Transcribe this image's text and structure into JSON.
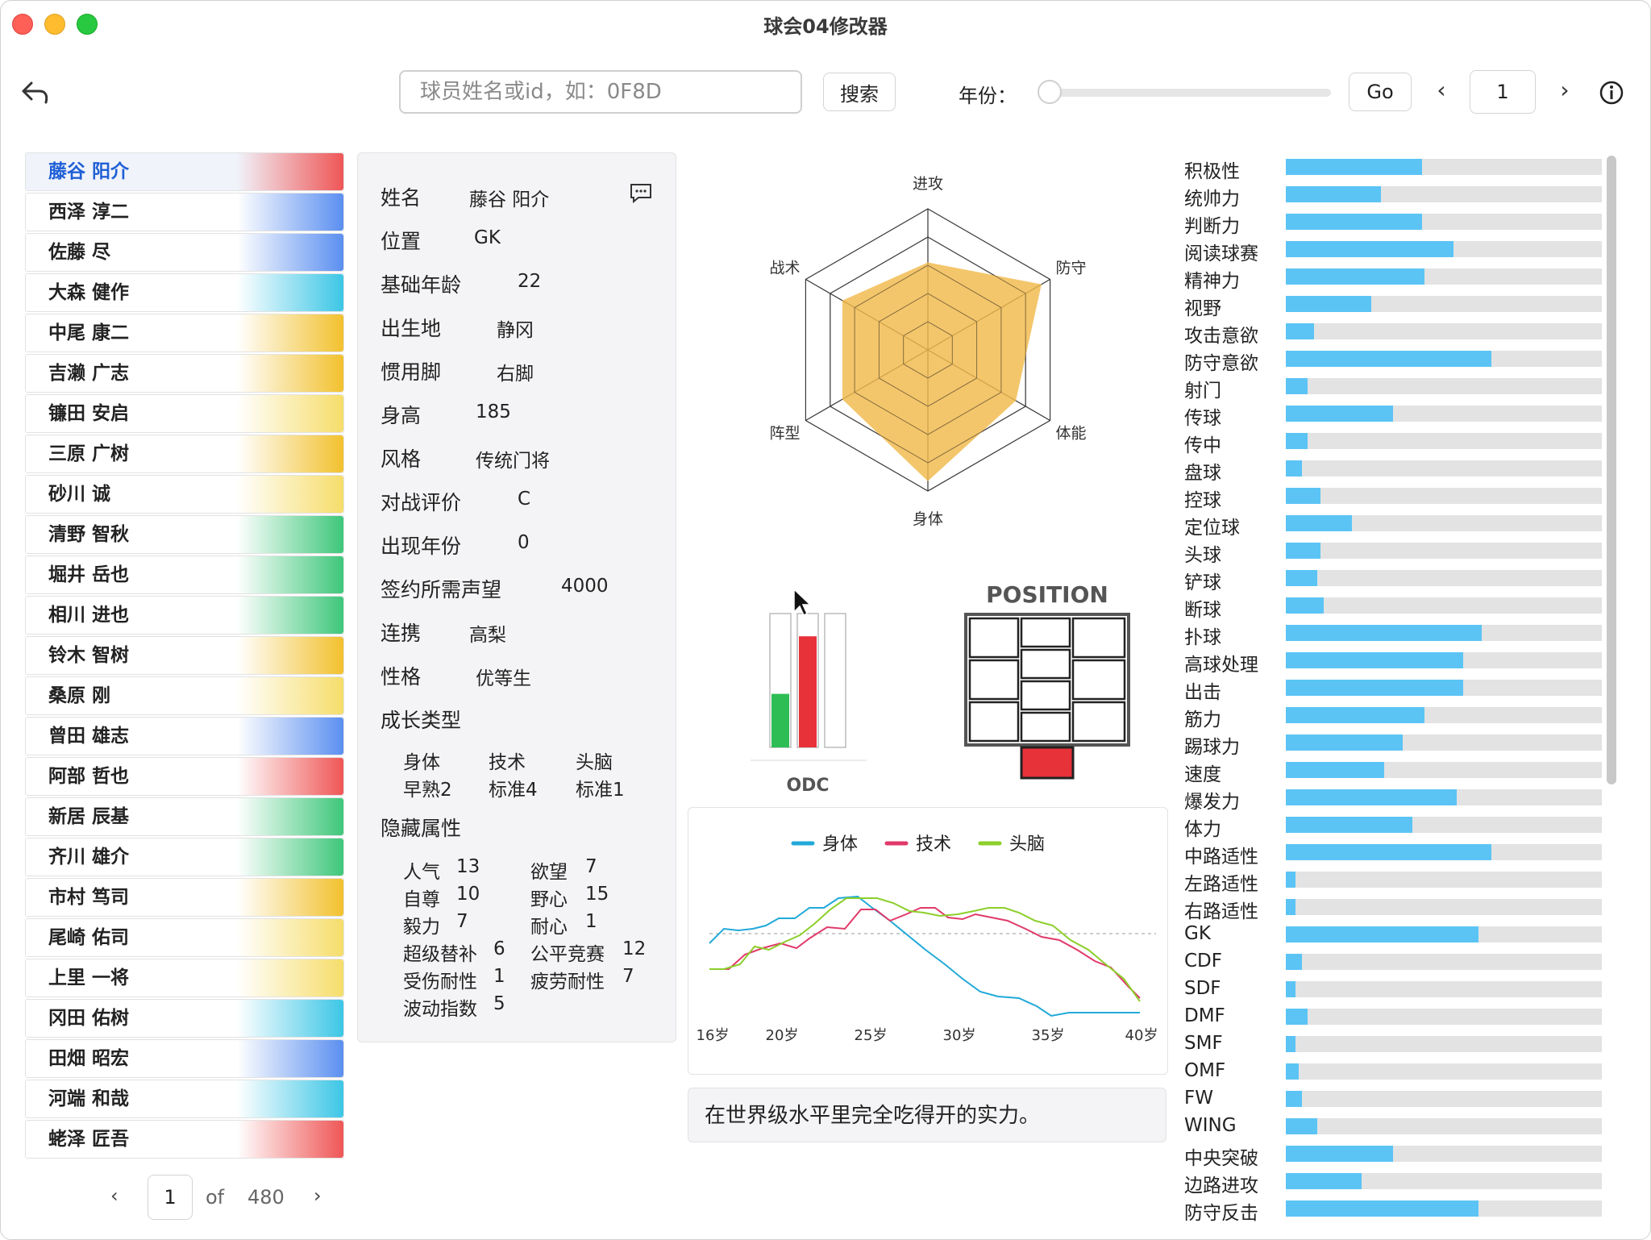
{
  "window": {
    "title": "球会04修改器"
  },
  "toolbar": {
    "search_placeholder": "球员姓名或id，如：0F8D",
    "search_button": "搜索",
    "year_label": "年份：",
    "year_slider_value": 0,
    "go_button": "Go",
    "page_prev": "‹",
    "page_value": "1",
    "page_next": "›"
  },
  "players": [
    {
      "name": "藤谷 阳介",
      "color": "#ef5656",
      "selected": true
    },
    {
      "name": "西泽 淳二",
      "color": "#5b8ff0"
    },
    {
      "name": "佐藤 尽",
      "color": "#5b8ff0"
    },
    {
      "name": "大森 健作",
      "color": "#3cc6e6"
    },
    {
      "name": "中尾 康二",
      "color": "#f2c12e"
    },
    {
      "name": "吉濑 广志",
      "color": "#f2c12e"
    },
    {
      "name": "镰田 安启",
      "color": "#f6dd6a"
    },
    {
      "name": "三原 广树",
      "color": "#f2c12e"
    },
    {
      "name": "砂川 诚",
      "color": "#f6dd6a"
    },
    {
      "name": "清野 智秋",
      "color": "#3ec77a"
    },
    {
      "name": "堀井 岳也",
      "color": "#3ec77a"
    },
    {
      "name": "相川 进也",
      "color": "#3ec77a"
    },
    {
      "name": "铃木 智树",
      "color": "#f2c12e"
    },
    {
      "name": "桑原 刚",
      "color": "#f6dd6a"
    },
    {
      "name": "曾田 雄志",
      "color": "#5b8ff0"
    },
    {
      "name": "阿部 哲也",
      "color": "#ef5656"
    },
    {
      "name": "新居 辰基",
      "color": "#3ec77a"
    },
    {
      "name": "齐川 雄介",
      "color": "#3ec77a"
    },
    {
      "name": "市村 笃司",
      "color": "#f2c12e"
    },
    {
      "name": "尾崎 佑司",
      "color": "#f6dd6a"
    },
    {
      "name": "上里 一将",
      "color": "#f6dd6a"
    },
    {
      "name": "冈田 佑树",
      "color": "#3cc6e6"
    },
    {
      "name": "田畑 昭宏",
      "color": "#5b8ff0"
    },
    {
      "name": "河端 和哉",
      "color": "#3cc6e6"
    },
    {
      "name": "蛯泽 匠吾",
      "color": "#ef5656"
    }
  ],
  "pager": {
    "prev": "‹",
    "current": "1",
    "of": "of",
    "total": "480",
    "next": "›"
  },
  "info": {
    "name_label": "姓名",
    "name_value": "藤谷 阳介",
    "pos_label": "位置",
    "pos_value": "GK",
    "age_label": "基础年龄",
    "age_value": "22",
    "birth_label": "出生地",
    "birth_value": "静冈",
    "foot_label": "惯用脚",
    "foot_value": "右脚",
    "height_label": "身高",
    "height_value": "185",
    "style_label": "风格",
    "style_value": "传统门将",
    "rating_label": "对战评价",
    "rating_value": "C",
    "year_label": "出现年份",
    "year_value": "0",
    "fame_label": "签约所需声望",
    "fame_value": "4000",
    "link_label": "连携",
    "link_value": "高梨",
    "char_label": "性格",
    "char_value": "优等生",
    "growth_label": "成长类型",
    "growth": [
      {
        "head": "身体",
        "val": "早熟2"
      },
      {
        "head": "技术",
        "val": "标准4"
      },
      {
        "head": "头脑",
        "val": "标准1"
      }
    ],
    "hidden_label": "隐藏属性",
    "hidden": [
      {
        "k": "人气",
        "v": "13"
      },
      {
        "k": "欲望",
        "v": "7"
      },
      {
        "k": "自尊",
        "v": "10"
      },
      {
        "k": "野心",
        "v": "15"
      },
      {
        "k": "毅力",
        "v": "7"
      },
      {
        "k": "耐心",
        "v": "1"
      },
      {
        "k": "超级替补",
        "v": "6"
      },
      {
        "k": "公平竞赛",
        "v": "12"
      },
      {
        "k": "受伤耐性",
        "v": "1"
      },
      {
        "k": "疲劳耐性",
        "v": "7"
      },
      {
        "k": "波动指数",
        "v": "5"
      }
    ]
  },
  "radar": {
    "labels": [
      "进攻",
      "防守",
      "体能",
      "身体",
      "阵型",
      "战术"
    ],
    "values": [
      0.62,
      0.93,
      0.72,
      0.93,
      0.7,
      0.7
    ],
    "fill_color": "#f2b94b"
  },
  "odc": {
    "label": "ODC",
    "levels": [
      0.4,
      0.83,
      0.0
    ],
    "colors": [
      "#2ebd55",
      "#e8323a",
      "#ffffff"
    ]
  },
  "position": {
    "title": "POSITION",
    "active": "GK",
    "active_color": "#e8323a"
  },
  "growth_chart": {
    "legend": [
      {
        "name": "身体",
        "color": "#21a9d8"
      },
      {
        "name": "技术",
        "color": "#e03a6a"
      },
      {
        "name": "头脑",
        "color": "#8ccf2a"
      }
    ],
    "x_labels": [
      "16岁",
      "20岁",
      "25岁",
      "30岁",
      "35岁",
      "40岁"
    ]
  },
  "description": "在世界级水平里完全吃得开的实力。",
  "attributes": [
    {
      "name": "积极性",
      "value": 0.43
    },
    {
      "name": "统帅力",
      "value": 0.3
    },
    {
      "name": "判断力",
      "value": 0.43
    },
    {
      "name": "阅读球赛",
      "value": 0.53
    },
    {
      "name": "精神力",
      "value": 0.44
    },
    {
      "name": "视野",
      "value": 0.27
    },
    {
      "name": "攻击意欲",
      "value": 0.09
    },
    {
      "name": "防守意欲",
      "value": 0.65
    },
    {
      "name": "射门",
      "value": 0.07
    },
    {
      "name": "传球",
      "value": 0.34
    },
    {
      "name": "传中",
      "value": 0.07
    },
    {
      "name": "盘球",
      "value": 0.05
    },
    {
      "name": "控球",
      "value": 0.11
    },
    {
      "name": "定位球",
      "value": 0.21
    },
    {
      "name": "头球",
      "value": 0.11
    },
    {
      "name": "铲球",
      "value": 0.1
    },
    {
      "name": "断球",
      "value": 0.12
    },
    {
      "name": "扑球",
      "value": 0.62
    },
    {
      "name": "高球处理",
      "value": 0.56
    },
    {
      "name": "出击",
      "value": 0.56
    },
    {
      "name": "筋力",
      "value": 0.44
    },
    {
      "name": "踢球力",
      "value": 0.37
    },
    {
      "name": "速度",
      "value": 0.31
    },
    {
      "name": "爆发力",
      "value": 0.54
    },
    {
      "name": "体力",
      "value": 0.4
    },
    {
      "name": "中路适性",
      "value": 0.65
    },
    {
      "name": "左路适性",
      "value": 0.03
    },
    {
      "name": "右路适性",
      "value": 0.03
    },
    {
      "name": "GK",
      "value": 0.61
    },
    {
      "name": "CDF",
      "value": 0.05
    },
    {
      "name": "SDF",
      "value": 0.03
    },
    {
      "name": "DMF",
      "value": 0.07
    },
    {
      "name": "SMF",
      "value": 0.03
    },
    {
      "name": "OMF",
      "value": 0.04
    },
    {
      "name": "FW",
      "value": 0.05
    },
    {
      "name": "WING",
      "value": 0.1
    },
    {
      "name": "中央突破",
      "value": 0.34
    },
    {
      "name": "边路进攻",
      "value": 0.24
    },
    {
      "name": "防守反击",
      "value": 0.61
    }
  ]
}
